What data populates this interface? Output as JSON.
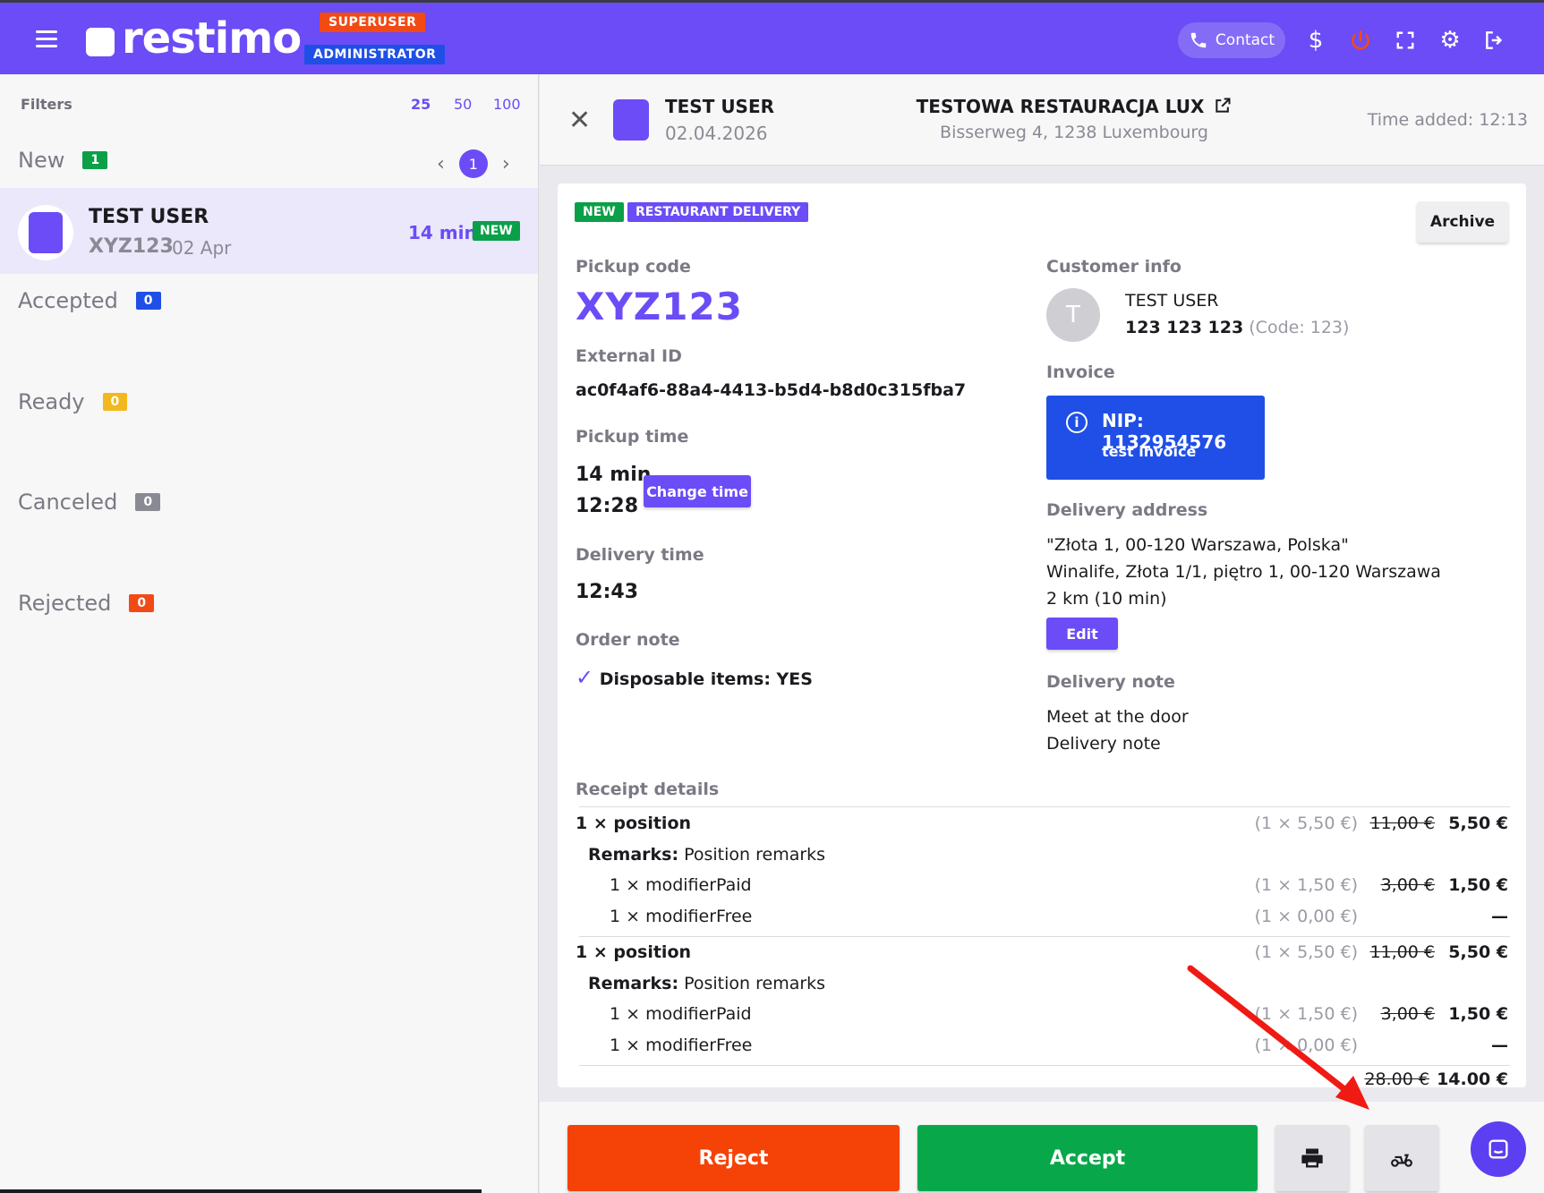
{
  "header": {
    "logo_text": "restimo",
    "role_superuser": "SUPERUSER",
    "role_admin": "ADMINISTRATOR",
    "contact_label": "Contact",
    "icons": [
      "menu-icon",
      "phone-icon",
      "dollar-icon",
      "power-icon",
      "fullscreen-icon",
      "gear-icon",
      "logout-icon"
    ],
    "colors": {
      "brand": "#6b4cf6",
      "superuser": "#f24a14",
      "admin": "#1f4fe6"
    }
  },
  "sidebar": {
    "filters_label": "Filters",
    "page_sizes": [
      "25",
      "50",
      "100"
    ],
    "pager": {
      "prev": "‹",
      "page": "1",
      "next": "›"
    },
    "sections": [
      {
        "label": "New",
        "count": "1",
        "color": "#0aa048"
      },
      {
        "label": "Accepted",
        "count": "0",
        "color": "#1f4fe6"
      },
      {
        "label": "Ready",
        "count": "0",
        "color": "#f2b81e"
      },
      {
        "label": "Canceled",
        "count": "0",
        "color": "#8a8a94"
      },
      {
        "label": "Rejected",
        "count": "0",
        "color": "#f24a14"
      }
    ],
    "order": {
      "name": "TEST USER",
      "code": "XYZ123",
      "date": "02 Apr",
      "eta": "14 min",
      "status": "NEW"
    }
  },
  "detail": {
    "customer_name": "TEST USER",
    "date": "02.04.2026",
    "restaurant": "TESTOWA RESTAURACJA LUX",
    "restaurant_address": "Bisserweg 4, 1238 Luxembourg",
    "time_added": "Time added:  12:13",
    "tags": [
      "NEW",
      "RESTAURANT DELIVERY"
    ],
    "archive_label": "Archive",
    "pickup_code_label": "Pickup code",
    "pickup_code": "XYZ123",
    "external_id_label": "External ID",
    "external_id": "ac0f4af6-88a4-4413-b5d4-b8d0c315fba7",
    "pickup_time_label": "Pickup time",
    "pickup_eta": "14 min",
    "pickup_clock": "12:28",
    "change_time_label": "Change time",
    "delivery_time_label": "Delivery time",
    "delivery_time": "12:43",
    "order_note_label": "Order note",
    "order_note": "Disposable items: YES",
    "customer_info_label": "Customer info",
    "customer_initial": "T",
    "customer_phone": "123 123 123",
    "customer_code": "(Code: 123)",
    "invoice_label": "Invoice",
    "invoice_nip": "NIP: 1132954576",
    "invoice_note": "test invoice",
    "delivery_address_label": "Delivery address",
    "delivery_address_1": "\"Złota 1, 00-120 Warszawa, Polska\"",
    "delivery_address_2": "Winalife, Złota 1/1, piętro 1, 00-120 Warszawa",
    "delivery_distance": "2 km (10 min)",
    "edit_label": "Edit",
    "delivery_note_label": "Delivery note",
    "delivery_note_1": "Meet at the door",
    "delivery_note_2": "Delivery note"
  },
  "receipt": {
    "label": "Receipt details",
    "rows": [
      {
        "left": "1 × position",
        "unit": "(1 × 5,50 €)",
        "old": "11,00 €",
        "price": "5,50 €"
      },
      {
        "remarks_label": "Remarks:",
        "remarks": " Position remarks"
      },
      {
        "left": "1 × modifierPaid",
        "unit": "(1 × 1,50 €)",
        "old": "3,00 €",
        "price": "1,50 €"
      },
      {
        "left": "1 × modifierFree",
        "unit": "(1 × 0,00 €)",
        "old": "",
        "price": "—"
      },
      {
        "left": "1 × position",
        "unit": "(1 × 5,50 €)",
        "old": "11,00 €",
        "price": "5,50 €"
      },
      {
        "remarks_label": "Remarks:",
        "remarks": " Position remarks"
      },
      {
        "left": "1 × modifierPaid",
        "unit": "(1 × 1,50 €)",
        "old": "3,00 €",
        "price": "1,50 €"
      },
      {
        "left": "1 × modifierFree",
        "unit": "(1 × 0,00 €)",
        "old": "",
        "price": "—"
      }
    ],
    "total_old": "28.00 €",
    "total": "14.00 €"
  },
  "actions": {
    "reject_label": "Reject",
    "accept_label": "Accept",
    "reject_color": "#f54307",
    "accept_color": "#08a84a"
  }
}
